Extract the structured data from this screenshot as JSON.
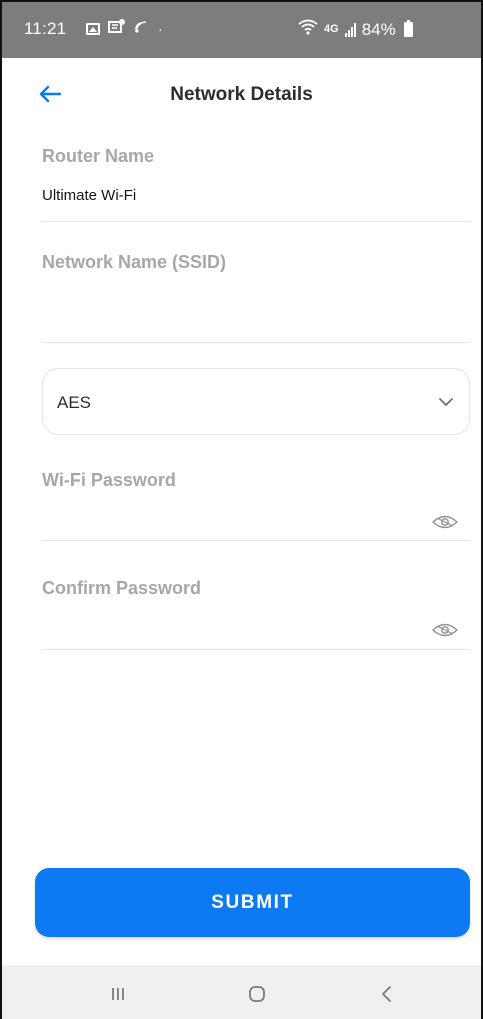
{
  "status_bar": {
    "time": "11:21",
    "left_icons": [
      "gallery-icon",
      "notification-icon",
      "cast-icon",
      "dot-icon"
    ],
    "network_type": "4G",
    "battery": "84%"
  },
  "header": {
    "back_icon": "arrow-left-icon",
    "title": "Network Details"
  },
  "form": {
    "router_name": {
      "label": "Router Name",
      "value": "Ultimate Wi-Fi"
    },
    "ssid": {
      "label": "Network Name (SSID)",
      "value": ""
    },
    "encryption": {
      "value": "AES",
      "icon": "chevron-down-icon"
    },
    "wifi_password": {
      "label": "Wi-Fi Password",
      "value": "",
      "icon": "eye-icon"
    },
    "confirm_password": {
      "label": "Confirm Password",
      "value": "",
      "icon": "eye-icon"
    }
  },
  "submit": {
    "label": "SUBMIT"
  },
  "nav": {
    "items": [
      "recent-apps-icon",
      "home-icon",
      "back-icon"
    ]
  },
  "colors": {
    "accent": "#0d79f2",
    "label": "#a5a7ab",
    "status_bar": "#7d7d7d"
  }
}
